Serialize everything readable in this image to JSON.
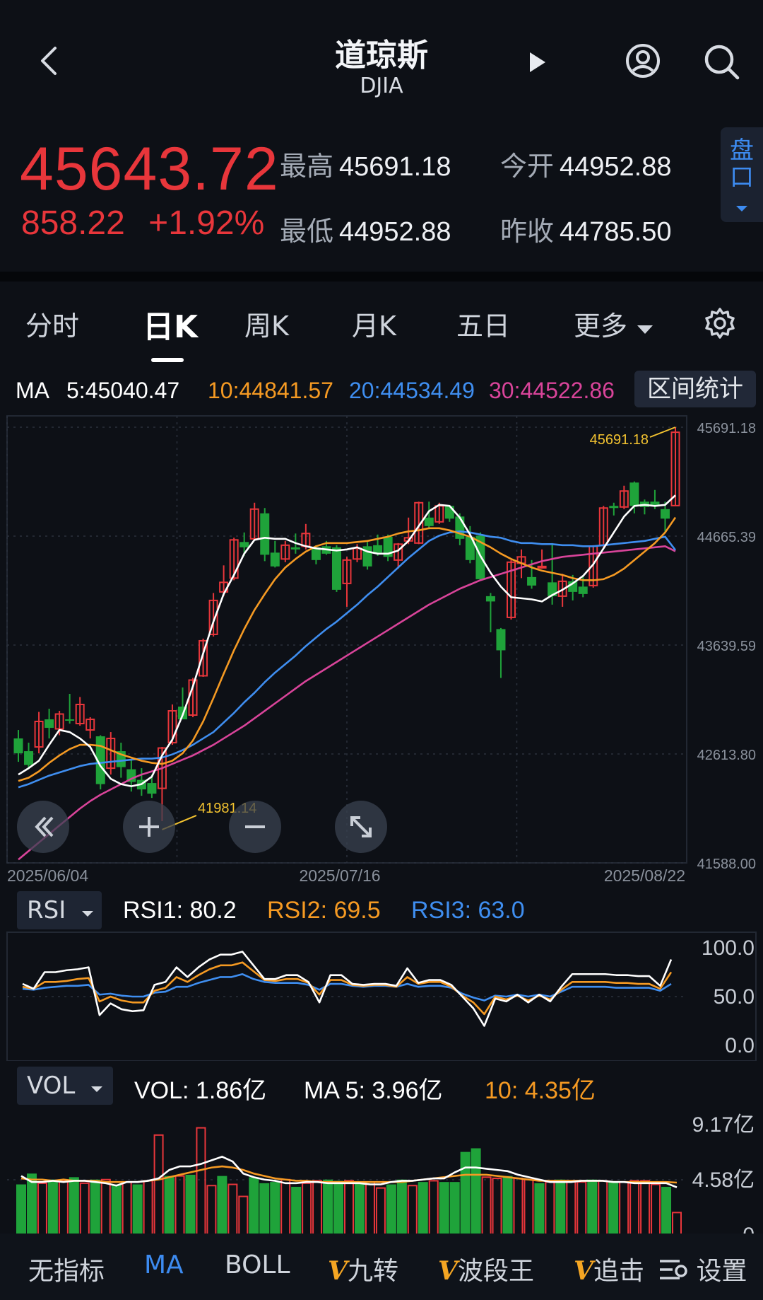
{
  "header": {
    "title": "道琼斯",
    "subtitle": "DJIA"
  },
  "quote": {
    "price": "45643.72",
    "change": "858.22",
    "change_pct": "+1.92%",
    "high_label": "最高",
    "high": "45691.18",
    "low_label": "最低",
    "low": "44952.88",
    "open_label": "今开",
    "open": "44952.88",
    "prev_label": "昨收",
    "prev_close": "44785.50",
    "pankou": "盘口"
  },
  "tabs": [
    "分时",
    "日K",
    "周K",
    "月K",
    "五日",
    "更多"
  ],
  "active_tab": "日K",
  "ma": {
    "label": "MA",
    "ma5": "5:45040.47",
    "ma10": "10:44841.57",
    "ma20": "20:44534.49",
    "ma30": "30:44522.86",
    "stats_button": "区间统计"
  },
  "colors": {
    "up": "#e8363b",
    "down": "#1fa33a",
    "ma5": "#ffffff",
    "ma10": "#f59a23",
    "ma20": "#3f8ef0",
    "ma30": "#d9449a",
    "accent": "#3d8bf0",
    "hi_lo": "#f2c230"
  },
  "price_axis": [
    "45691.18",
    "44665.39",
    "43639.59",
    "42613.80",
    "41588.00"
  ],
  "date_axis": [
    "2025/06/04",
    "2025/07/16",
    "2025/08/22"
  ],
  "annotations": {
    "high": "45691.18",
    "low": "41981.14"
  },
  "rsi": {
    "selector": "RSI",
    "rsi1": "RSI1: 80.2",
    "rsi2": "RSI2: 69.5",
    "rsi3": "RSI3: 63.0",
    "axis": [
      "100.0",
      "50.0",
      "0.0"
    ]
  },
  "vol": {
    "selector": "VOL",
    "vol": "VOL: 1.86亿",
    "ma5": "MA 5: 3.96亿",
    "ma10": "10: 4.35亿",
    "axis": [
      "9.17亿",
      "4.58亿",
      "0"
    ]
  },
  "bottom_nav": [
    "无指标",
    "MA",
    "BOLL",
    "九转",
    "波段王",
    "追击",
    "设置"
  ],
  "bottom_nav_active": "MA",
  "chart_data": {
    "type": "candlestick",
    "x_start": "2025/06/04",
    "x_end": "2025/08/25",
    "ylim": [
      41588.0,
      45691.18
    ],
    "candles": [
      {
        "o": 42760,
        "h": 42840,
        "l": 42540,
        "c": 42620
      },
      {
        "o": 42640,
        "h": 42720,
        "l": 42480,
        "c": 42510
      },
      {
        "o": 42680,
        "h": 43010,
        "l": 42620,
        "c": 42920
      },
      {
        "o": 42940,
        "h": 43040,
        "l": 42760,
        "c": 42860
      },
      {
        "o": 42850,
        "h": 43020,
        "l": 42790,
        "c": 42990
      },
      {
        "o": 42940,
        "h": 43180,
        "l": 42900,
        "c": 42930
      },
      {
        "o": 42900,
        "h": 43150,
        "l": 42880,
        "c": 43080
      },
      {
        "o": 42840,
        "h": 42960,
        "l": 42760,
        "c": 42940
      },
      {
        "o": 42780,
        "h": 42790,
        "l": 42280,
        "c": 42330
      },
      {
        "o": 42480,
        "h": 42820,
        "l": 42420,
        "c": 42760
      },
      {
        "o": 42640,
        "h": 42720,
        "l": 42390,
        "c": 42490
      },
      {
        "o": 42470,
        "h": 42560,
        "l": 42260,
        "c": 42350
      },
      {
        "o": 42370,
        "h": 42480,
        "l": 42220,
        "c": 42280
      },
      {
        "o": 42340,
        "h": 42420,
        "l": 42200,
        "c": 42240
      },
      {
        "o": 42290,
        "h": 42680,
        "l": 41981.14,
        "c": 42670
      },
      {
        "o": 42720,
        "h": 43080,
        "l": 42700,
        "c": 43020
      },
      {
        "o": 43060,
        "h": 43240,
        "l": 42960,
        "c": 42940
      },
      {
        "o": 42980,
        "h": 43330,
        "l": 42960,
        "c": 43310
      },
      {
        "o": 43350,
        "h": 43700,
        "l": 43340,
        "c": 43680
      },
      {
        "o": 43740,
        "h": 44130,
        "l": 43720,
        "c": 44060
      },
      {
        "o": 44140,
        "h": 44390,
        "l": 44100,
        "c": 44230
      },
      {
        "o": 44270,
        "h": 44650,
        "l": 44250,
        "c": 44630
      },
      {
        "o": 44610,
        "h": 44700,
        "l": 44480,
        "c": 44560
      },
      {
        "o": 44640,
        "h": 44980,
        "l": 44630,
        "c": 44920
      },
      {
        "o": 44880,
        "h": 44930,
        "l": 44430,
        "c": 44490
      },
      {
        "o": 44510,
        "h": 44620,
        "l": 44370,
        "c": 44380
      },
      {
        "o": 44450,
        "h": 44620,
        "l": 44420,
        "c": 44580
      },
      {
        "o": 44560,
        "h": 44690,
        "l": 44500,
        "c": 44540
      },
      {
        "o": 44570,
        "h": 44780,
        "l": 44540,
        "c": 44690
      },
      {
        "o": 44560,
        "h": 44580,
        "l": 44400,
        "c": 44440
      },
      {
        "o": 44570,
        "h": 44620,
        "l": 44490,
        "c": 44500
      },
      {
        "o": 44560,
        "h": 44580,
        "l": 44140,
        "c": 44160
      },
      {
        "o": 44220,
        "h": 44470,
        "l": 44000,
        "c": 44440
      },
      {
        "o": 44450,
        "h": 44590,
        "l": 44420,
        "c": 44550
      },
      {
        "o": 44570,
        "h": 44610,
        "l": 44350,
        "c": 44380
      },
      {
        "o": 44580,
        "h": 44680,
        "l": 44480,
        "c": 44510
      },
      {
        "o": 44660,
        "h": 44680,
        "l": 44430,
        "c": 44470
      },
      {
        "o": 44440,
        "h": 44600,
        "l": 44360,
        "c": 44590
      },
      {
        "o": 44620,
        "h": 44840,
        "l": 44590,
        "c": 44650
      },
      {
        "o": 44600,
        "h": 44990,
        "l": 44590,
        "c": 44980
      },
      {
        "o": 44840,
        "h": 44990,
        "l": 44730,
        "c": 44760
      },
      {
        "o": 44800,
        "h": 44980,
        "l": 44780,
        "c": 44950
      },
      {
        "o": 44950,
        "h": 44960,
        "l": 44800,
        "c": 44830
      },
      {
        "o": 44850,
        "h": 44880,
        "l": 44580,
        "c": 44640
      },
      {
        "o": 44660,
        "h": 44760,
        "l": 44410,
        "c": 44440
      },
      {
        "o": 44670,
        "h": 44700,
        "l": 44250,
        "c": 44260
      },
      {
        "o": 44100,
        "h": 44130,
        "l": 43760,
        "c": 44050
      },
      {
        "o": 43790,
        "h": 43800,
        "l": 43330,
        "c": 43590
      },
      {
        "o": 43900,
        "h": 44440,
        "l": 43880,
        "c": 44420
      },
      {
        "o": 44410,
        "h": 44540,
        "l": 44270,
        "c": 44470
      },
      {
        "o": 44280,
        "h": 44440,
        "l": 44170,
        "c": 44200
      },
      {
        "o": 44380,
        "h": 44540,
        "l": 44360,
        "c": 44380
      },
      {
        "o": 44230,
        "h": 44600,
        "l": 44020,
        "c": 44100
      },
      {
        "o": 44100,
        "h": 44310,
        "l": 44000,
        "c": 44240
      },
      {
        "o": 44240,
        "h": 44300,
        "l": 44060,
        "c": 44140
      },
      {
        "o": 44190,
        "h": 44290,
        "l": 44090,
        "c": 44120
      },
      {
        "o": 44200,
        "h": 44580,
        "l": 44180,
        "c": 44570
      },
      {
        "o": 44580,
        "h": 44950,
        "l": 44560,
        "c": 44930
      },
      {
        "o": 44950,
        "h": 44980,
        "l": 44860,
        "c": 44930
      },
      {
        "o": 44940,
        "h": 45140,
        "l": 44920,
        "c": 45090
      },
      {
        "o": 45170,
        "h": 45180,
        "l": 44880,
        "c": 44950
      },
      {
        "o": 44990,
        "h": 45010,
        "l": 44870,
        "c": 44940
      },
      {
        "o": 44990,
        "h": 45100,
        "l": 44920,
        "c": 44960
      },
      {
        "o": 44920,
        "h": 44990,
        "l": 44700,
        "c": 44830
      },
      {
        "o": 44952.88,
        "h": 45691.18,
        "l": 44952.88,
        "c": 45643.72
      }
    ],
    "ma5": [
      42420,
      42480,
      42550,
      42700,
      42840,
      42820,
      42760,
      42680,
      42500,
      42380,
      42330,
      42310,
      42330,
      42400,
      42600,
      42750,
      42980,
      43250,
      43560,
      43860,
      44120,
      44300,
      44500,
      44630,
      44650,
      44640,
      44640,
      44600,
      44570,
      44550,
      44540,
      44530,
      44540,
      44560,
      44520,
      44500,
      44500,
      44530,
      44620,
      44760,
      44900,
      44960,
      44950,
      44840,
      44680,
      44480,
      44320,
      44190,
      44090,
      44080,
      44070,
      44050,
      44110,
      44160,
      44220,
      44290,
      44400,
      44550,
      44700,
      44850,
      44950,
      44960,
      44950,
      44960,
      45050
    ],
    "ma10": [
      42360,
      42390,
      42450,
      42530,
      42600,
      42660,
      42700,
      42700,
      42690,
      42650,
      42610,
      42580,
      42550,
      42530,
      42520,
      42550,
      42620,
      42740,
      42920,
      43140,
      43370,
      43590,
      43790,
      43970,
      44120,
      44260,
      44370,
      44450,
      44520,
      44570,
      44600,
      44600,
      44600,
      44610,
      44620,
      44640,
      44660,
      44690,
      44710,
      44720,
      44740,
      44740,
      44720,
      44690,
      44660,
      44610,
      44560,
      44500,
      44450,
      44410,
      44370,
      44340,
      44320,
      44300,
      44270,
      44250,
      44250,
      44260,
      44300,
      44360,
      44440,
      44520,
      44600,
      44700,
      44841.57
    ],
    "ma20": [
      42300,
      42330,
      42370,
      42410,
      42440,
      42470,
      42500,
      42520,
      42530,
      42540,
      42550,
      42560,
      42570,
      42570,
      42580,
      42610,
      42650,
      42700,
      42760,
      42820,
      42910,
      43000,
      43100,
      43190,
      43290,
      43380,
      43460,
      43540,
      43630,
      43710,
      43790,
      43860,
      43940,
      44020,
      44110,
      44190,
      44280,
      44370,
      44460,
      44540,
      44620,
      44670,
      44700,
      44710,
      44700,
      44680,
      44660,
      44650,
      44620,
      44600,
      44600,
      44590,
      44590,
      44580,
      44580,
      44570,
      44570,
      44580,
      44590,
      44600,
      44610,
      44620,
      44640,
      44660,
      44534.49
    ],
    "ma30": [
      41620,
      41700,
      41780,
      41860,
      41940,
      42020,
      42100,
      42170,
      42230,
      42280,
      42330,
      42380,
      42420,
      42450,
      42480,
      42520,
      42560,
      42600,
      42650,
      42700,
      42760,
      42820,
      42880,
      42950,
      43020,
      43090,
      43160,
      43230,
      43300,
      43360,
      43420,
      43480,
      43540,
      43600,
      43660,
      43720,
      43780,
      43840,
      43900,
      43960,
      44020,
      44070,
      44120,
      44170,
      44210,
      44250,
      44280,
      44310,
      44340,
      44370,
      44400,
      44430,
      44450,
      44470,
      44480,
      44490,
      44500,
      44510,
      44520,
      44530,
      44540,
      44550,
      44560,
      44570,
      44522.86
    ],
    "rsi1": [
      63,
      58,
      75,
      75,
      77,
      78,
      80,
      31,
      43,
      37,
      35,
      36,
      62,
      65,
      80,
      70,
      80,
      88,
      93,
      93,
      96,
      82,
      68,
      68,
      72,
      72,
      65,
      44,
      72,
      72,
      63,
      62,
      63,
      63,
      61,
      79,
      64,
      67,
      67,
      62,
      50,
      38,
      20,
      48,
      45,
      52,
      44,
      52,
      45,
      60,
      73,
      73,
      73,
      73,
      72,
      72,
      71,
      71,
      61,
      88
    ],
    "rsi2": [
      60,
      58,
      65,
      65,
      66,
      68,
      69,
      45,
      50,
      46,
      44,
      44,
      56,
      59,
      70,
      65,
      72,
      78,
      82,
      82,
      85,
      76,
      67,
      66,
      68,
      68,
      64,
      52,
      67,
      67,
      62,
      61,
      62,
      62,
      60,
      70,
      63,
      65,
      65,
      60,
      51,
      44,
      32,
      50,
      47,
      51,
      46,
      51,
      47,
      57,
      65,
      65,
      65,
      65,
      64,
      64,
      63,
      63,
      58,
      75
    ],
    "rsi3": [
      58,
      57,
      59,
      60,
      61,
      61,
      62,
      52,
      53,
      51,
      50,
      50,
      54,
      55,
      60,
      60,
      64,
      67,
      70,
      70,
      73,
      68,
      65,
      64,
      64,
      64,
      62,
      57,
      63,
      63,
      61,
      60,
      61,
      61,
      60,
      63,
      60,
      61,
      61,
      59,
      53,
      49,
      46,
      51,
      50,
      52,
      50,
      52,
      50,
      55,
      60,
      60,
      60,
      60,
      59,
      59,
      59,
      59,
      56,
      63
    ],
    "volume": [
      {
        "v": 4.2,
        "up": false
      },
      {
        "v": 5.1,
        "up": false
      },
      {
        "v": 4.3,
        "up": true
      },
      {
        "v": 4.6,
        "up": false
      },
      {
        "v": 4.5,
        "up": true
      },
      {
        "v": 4.8,
        "up": false
      },
      {
        "v": 4.3,
        "up": true
      },
      {
        "v": 4.6,
        "up": false
      },
      {
        "v": 4.6,
        "up": true
      },
      {
        "v": 4.2,
        "up": false
      },
      {
        "v": 4.4,
        "up": true
      },
      {
        "v": 4.2,
        "up": false
      },
      {
        "v": 4.5,
        "up": true
      },
      {
        "v": 8.3,
        "up": true
      },
      {
        "v": 4.9,
        "up": false
      },
      {
        "v": 4.9,
        "up": true
      },
      {
        "v": 5.0,
        "up": false
      },
      {
        "v": 8.9,
        "up": true
      },
      {
        "v": 4.1,
        "up": true
      },
      {
        "v": 4.9,
        "up": false
      },
      {
        "v": 4.2,
        "up": true
      },
      {
        "v": 3.2,
        "up": true
      },
      {
        "v": 4.8,
        "up": false
      },
      {
        "v": 4.3,
        "up": false
      },
      {
        "v": 4.4,
        "up": false
      },
      {
        "v": 4.6,
        "up": true
      },
      {
        "v": 4.0,
        "up": false
      },
      {
        "v": 4.3,
        "up": true
      },
      {
        "v": 4.5,
        "up": true
      },
      {
        "v": 4.6,
        "up": false
      },
      {
        "v": 4.5,
        "up": false
      },
      {
        "v": 4.5,
        "up": true
      },
      {
        "v": 4.3,
        "up": false
      },
      {
        "v": 4.4,
        "up": true
      },
      {
        "v": 3.9,
        "up": true
      },
      {
        "v": 4.2,
        "up": false
      },
      {
        "v": 4.6,
        "up": false
      },
      {
        "v": 4.1,
        "up": true
      },
      {
        "v": 4.4,
        "up": false
      },
      {
        "v": 4.5,
        "up": true
      },
      {
        "v": 4.4,
        "up": false
      },
      {
        "v": 4.4,
        "up": false
      },
      {
        "v": 6.9,
        "up": false
      },
      {
        "v": 7.2,
        "up": false
      },
      {
        "v": 4.8,
        "up": true
      },
      {
        "v": 4.7,
        "up": true
      },
      {
        "v": 4.9,
        "up": false
      },
      {
        "v": 4.7,
        "up": true
      },
      {
        "v": 4.6,
        "up": true
      },
      {
        "v": 4.3,
        "up": false
      },
      {
        "v": 4.4,
        "up": true
      },
      {
        "v": 4.6,
        "up": false
      },
      {
        "v": 4.5,
        "up": true
      },
      {
        "v": 4.4,
        "up": true
      },
      {
        "v": 4.6,
        "up": false
      },
      {
        "v": 4.5,
        "up": true
      },
      {
        "v": 4.4,
        "up": false
      },
      {
        "v": 4.4,
        "up": true
      },
      {
        "v": 4.5,
        "up": true
      },
      {
        "v": 4.5,
        "up": true
      },
      {
        "v": 4.2,
        "up": true
      },
      {
        "v": 4.0,
        "up": false
      },
      {
        "v": 1.86,
        "up": true
      }
    ],
    "vol_ma5": [
      4.9,
      4.4,
      4.4,
      4.5,
      4.4,
      4.5,
      4.5,
      4.4,
      4.3,
      4.1,
      4.4,
      4.4,
      4.5,
      4.7,
      5.4,
      5.7,
      5.7,
      5.9,
      6.2,
      6.5,
      6.1,
      5.1,
      4.8,
      4.6,
      4.5,
      4.3,
      4.3,
      4.4,
      4.4,
      4.3,
      4.3,
      4.3,
      4.3,
      4.2,
      4.2,
      4.4,
      4.5,
      4.5,
      4.6,
      4.7,
      4.7,
      5.2,
      5.6,
      5.6,
      5.5,
      5.4,
      5.3,
      5.0,
      4.8,
      4.6,
      4.4,
      4.4,
      4.4,
      4.5,
      4.5,
      4.5,
      4.4,
      4.4,
      4.3,
      4.3,
      4.3,
      4.3,
      3.96
    ],
    "vol_ma10": [
      4.7,
      4.6,
      4.6,
      4.5,
      4.6,
      4.5,
      4.5,
      4.5,
      4.4,
      4.4,
      4.4,
      4.4,
      4.5,
      4.6,
      4.8,
      5.0,
      5.2,
      5.4,
      5.6,
      5.7,
      5.6,
      5.4,
      5.1,
      4.9,
      4.7,
      4.6,
      4.5,
      4.5,
      4.4,
      4.4,
      4.4,
      4.4,
      4.4,
      4.4,
      4.4,
      4.4,
      4.4,
      4.5,
      4.6,
      4.7,
      4.8,
      4.9,
      5.0,
      5.0,
      5.0,
      4.9,
      4.8,
      4.7,
      4.6,
      4.5,
      4.5,
      4.5,
      4.5,
      4.5,
      4.5,
      4.5,
      4.4,
      4.4,
      4.4,
      4.4,
      4.4,
      4.4,
      4.35
    ],
    "vol_ylim": [
      0,
      9.17
    ]
  }
}
